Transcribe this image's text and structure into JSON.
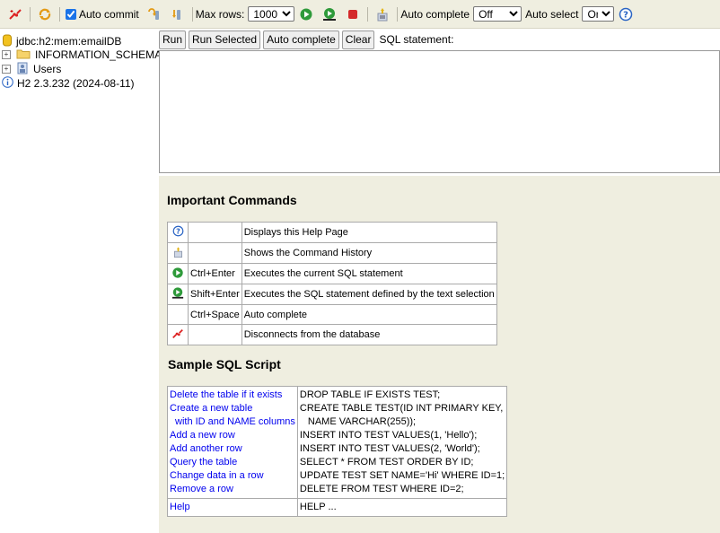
{
  "toolbar": {
    "auto_commit_label": "Auto commit",
    "auto_commit_checked": true,
    "max_rows_label": "Max rows:",
    "max_rows_value": "1000",
    "auto_complete_label": "Auto complete",
    "auto_complete_value": "Off",
    "auto_select_label": "Auto select",
    "auto_select_value": "On"
  },
  "tree": {
    "connection": "jdbc:h2:mem:emailDB",
    "items": [
      {
        "label": "INFORMATION_SCHEMA",
        "icon": "folder-icon"
      },
      {
        "label": "Users",
        "icon": "users-icon"
      }
    ],
    "version": "H2 2.3.232 (2024-08-11)"
  },
  "query": {
    "run": "Run",
    "run_selected": "Run Selected",
    "auto_complete": "Auto complete",
    "clear": "Clear",
    "sql_statement_label": "SQL statement:",
    "sql_text": ""
  },
  "help": {
    "important_commands_title": "Important Commands",
    "commands": [
      {
        "icon": "help-icon",
        "key": "",
        "description": "Displays this Help Page"
      },
      {
        "icon": "history-icon",
        "key": "",
        "description": "Shows the Command History"
      },
      {
        "icon": "run-icon",
        "key": "Ctrl+Enter",
        "description": "Executes the current SQL statement"
      },
      {
        "icon": "run-selected-icon",
        "key": "Shift+Enter",
        "description": "Executes the SQL statement defined by the text selection"
      },
      {
        "icon": "",
        "key": "Ctrl+Space",
        "description": "Auto complete"
      },
      {
        "icon": "disconnect-icon",
        "key": "",
        "description": "Disconnects from the database"
      }
    ],
    "sample_script_title": "Sample SQL Script",
    "script_links": [
      "Delete the table if it exists",
      "Create a new table",
      "with ID and NAME columns",
      "Add a new row",
      "Add another row",
      "Query the table",
      "Change data in a row",
      "Remove a row"
    ],
    "script_sql": [
      "DROP TABLE IF EXISTS TEST;",
      "CREATE TABLE TEST(ID INT PRIMARY KEY,",
      "NAME VARCHAR(255));",
      "INSERT INTO TEST VALUES(1, 'Hello');",
      "INSERT INTO TEST VALUES(2, 'World');",
      "SELECT * FROM TEST ORDER BY ID;",
      "UPDATE TEST SET NAME='Hi' WHERE ID=1;",
      "DELETE FROM TEST WHERE ID=2;"
    ],
    "help_link": "Help",
    "help_sql": "HELP ..."
  },
  "colors": {
    "panel_bg": "#efeee0",
    "link": "#0000ee",
    "run_green": "#2e9a3a",
    "stop_red": "#d42a2a"
  }
}
